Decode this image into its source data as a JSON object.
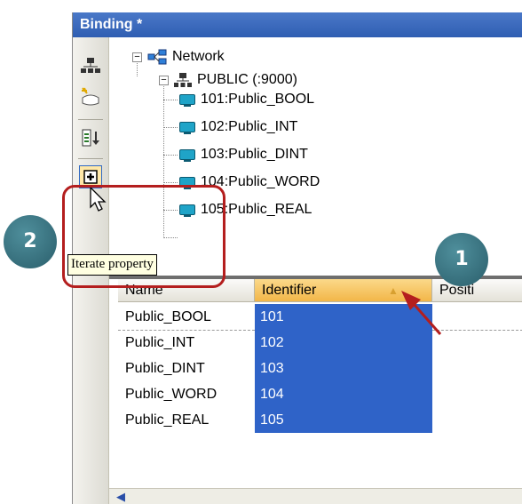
{
  "window": {
    "title": "Binding *"
  },
  "toolbar": {
    "buttons": [
      {
        "name": "network-tree-icon"
      },
      {
        "name": "new-binding-icon"
      },
      {
        "name": "sort-icon"
      },
      {
        "name": "iterate-property-icon"
      }
    ],
    "tooltip": "Iterate property"
  },
  "tree": {
    "root": {
      "label": "Network",
      "expander": "−"
    },
    "group": {
      "label": "PUBLIC (:9000)",
      "expander": "−"
    },
    "items": [
      {
        "label": "101:Public_BOOL"
      },
      {
        "label": "102:Public_INT"
      },
      {
        "label": "103:Public_DINT"
      },
      {
        "label": "104:Public_WORD"
      },
      {
        "label": "105:Public_REAL"
      }
    ]
  },
  "grid": {
    "columns": {
      "name": "Name",
      "identifier": "Identifier",
      "position": "Positi"
    },
    "rows": [
      {
        "name": "Public_BOOL",
        "identifier": "101"
      },
      {
        "name": "Public_INT",
        "identifier": "102"
      },
      {
        "name": "Public_DINT",
        "identifier": "103"
      },
      {
        "name": "Public_WORD",
        "identifier": "104"
      },
      {
        "name": "Public_REAL",
        "identifier": "105"
      }
    ],
    "sort_indicator": "▲"
  },
  "callouts": {
    "badge1": "1",
    "badge2": "2"
  },
  "colors": {
    "title_bar": "#2f5eb2",
    "selection": "#2f63c8",
    "highlight": "#b41e1e",
    "badge": "#2a5e6b"
  }
}
